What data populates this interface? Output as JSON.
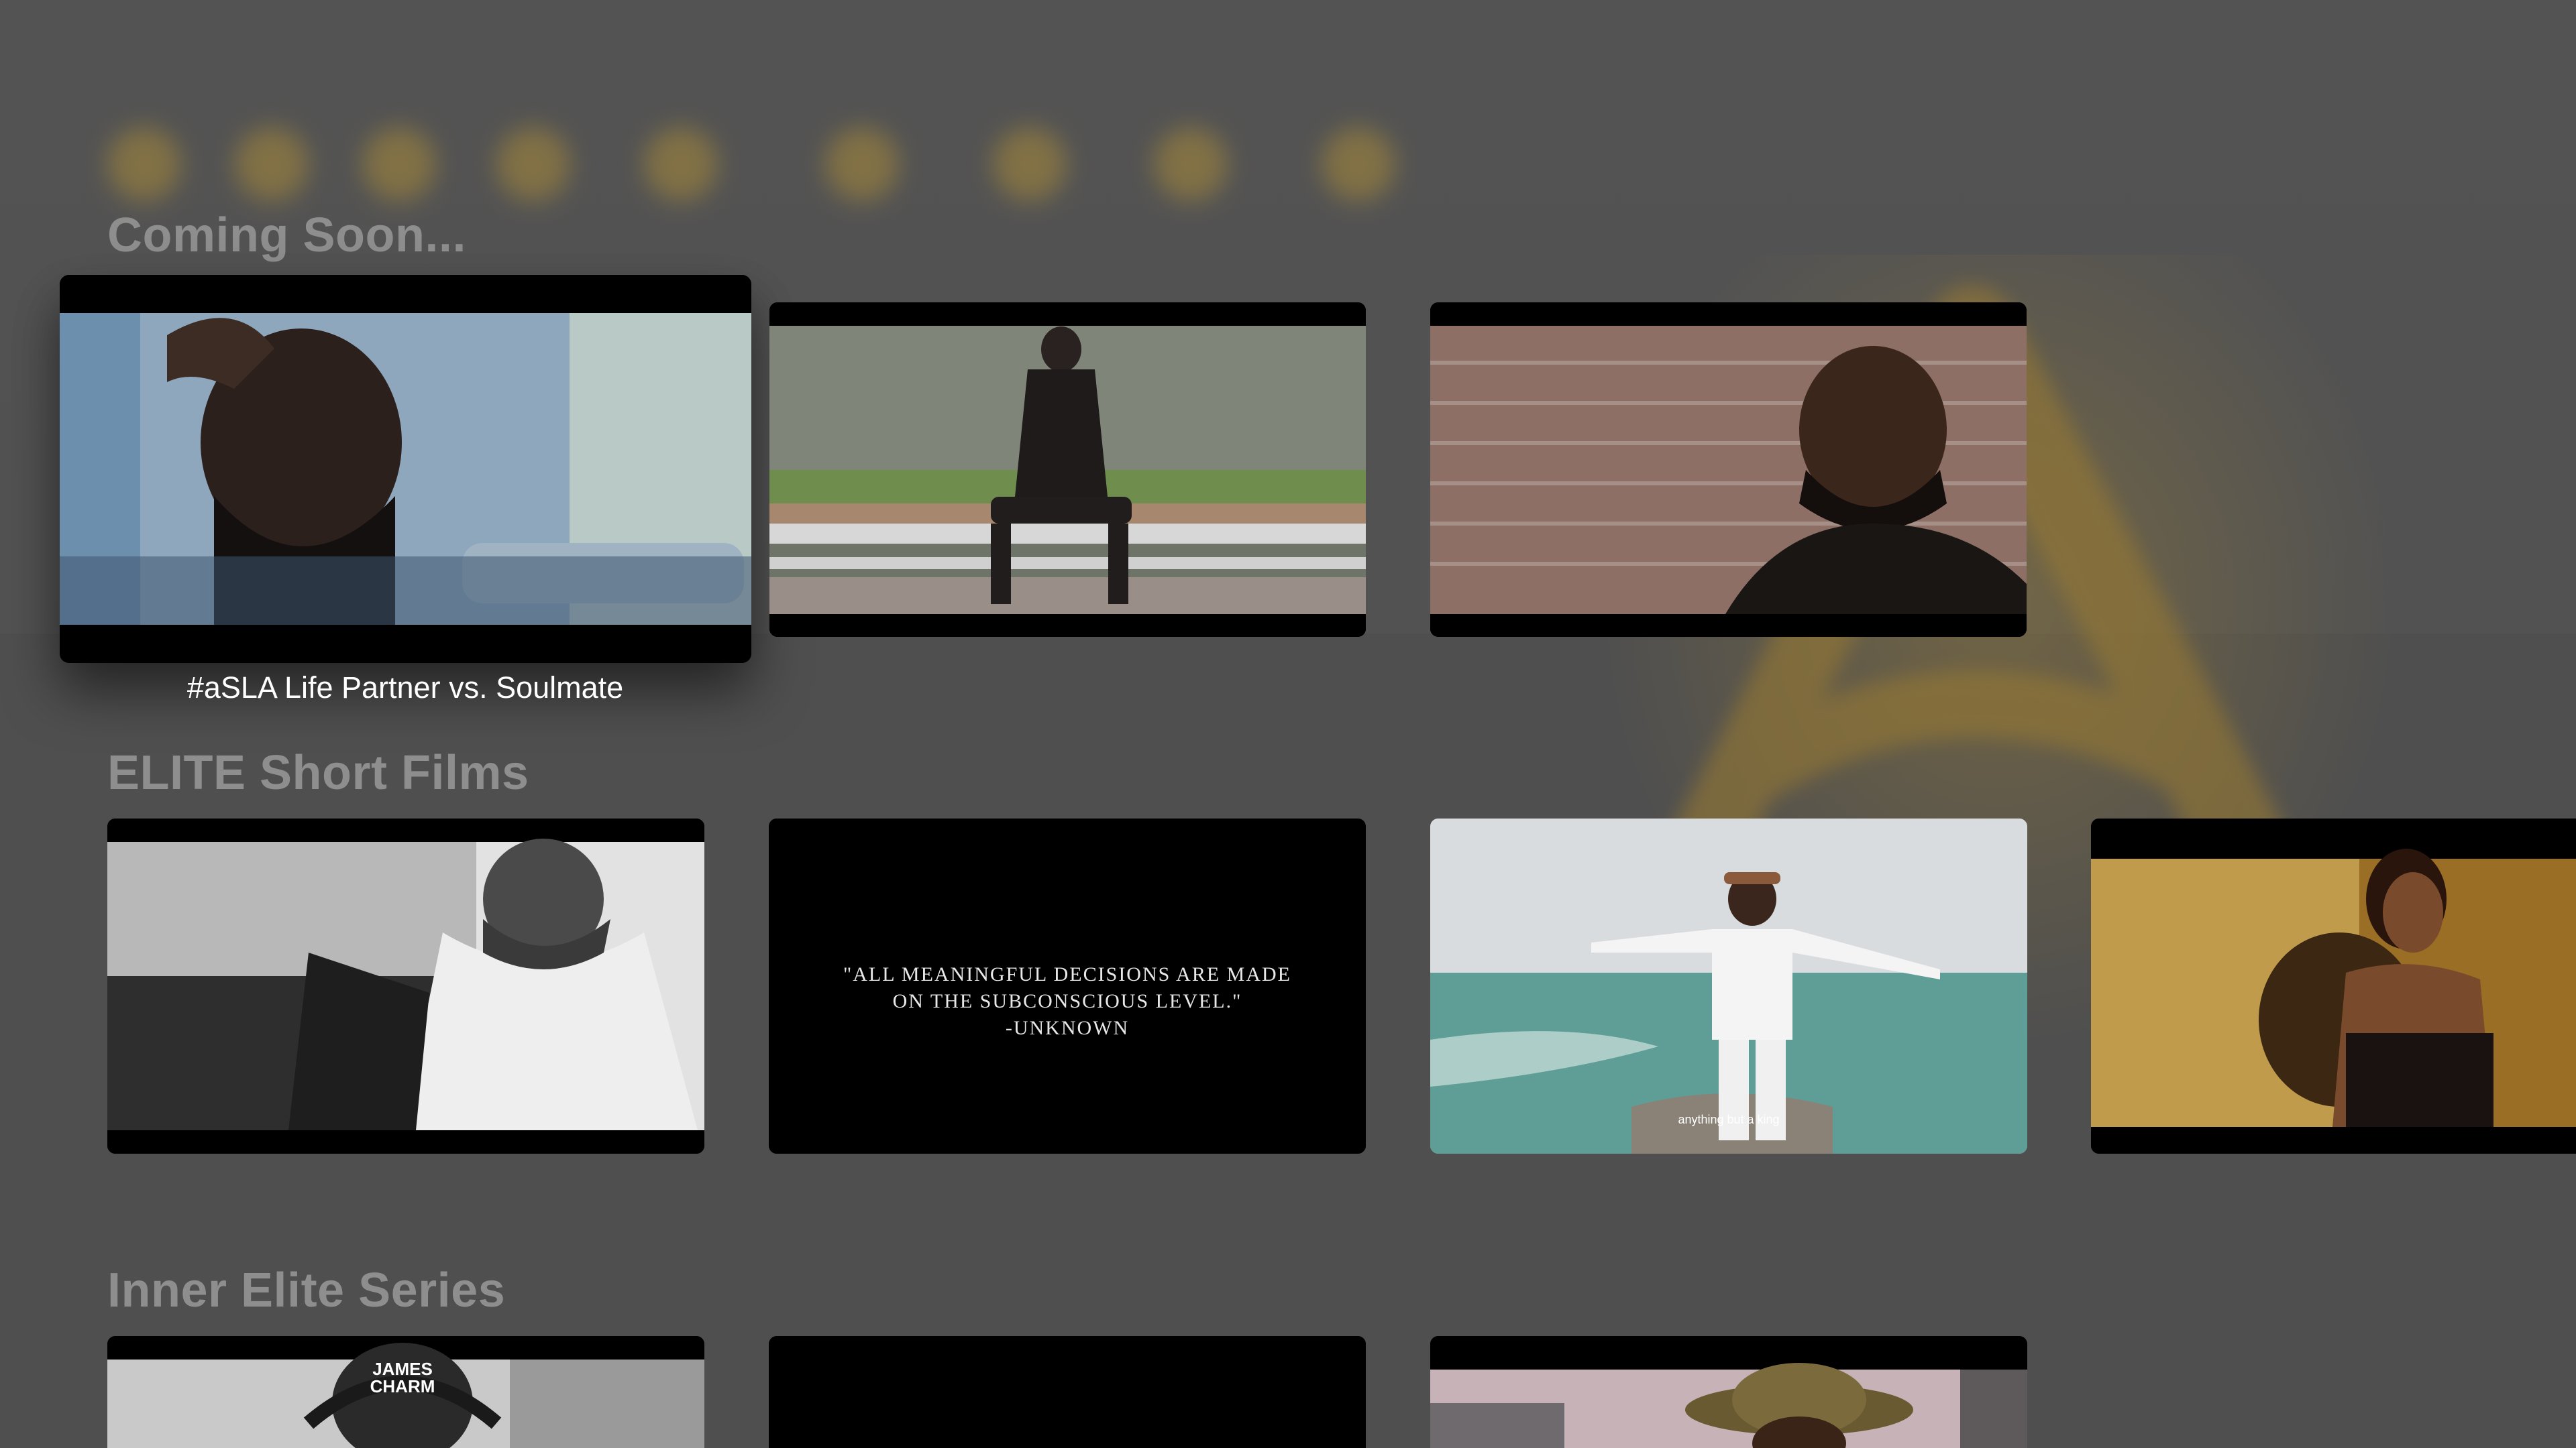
{
  "sections": [
    {
      "title": "Coming Soon...",
      "items": [
        {
          "scene": "man-in-car",
          "caption": "#aSLA Life Partner vs. Soulmate",
          "focused": true
        },
        {
          "scene": "man-on-bleachers"
        },
        {
          "scene": "man-brick-wall"
        }
      ]
    },
    {
      "title": "ELITE Short Films",
      "items": [
        {
          "scene": "bw-man-with-scarf"
        },
        {
          "scene": "quote-card",
          "quote": [
            "\"ALL MEANINGFUL DECISIONS ARE MADE",
            "ON THE SUBCONSCIOUS LEVEL.\"",
            "-UNKNOWN"
          ]
        },
        {
          "scene": "man-arms-outstretched-sea",
          "subtitle": "anything but a king"
        },
        {
          "scene": "woman-speaking"
        }
      ]
    },
    {
      "title": "Inner Elite Series",
      "items": [
        {
          "scene": "man-with-headphones",
          "cap_text": [
            "JAMES",
            "CHARM"
          ]
        },
        {
          "scene": "black-card"
        },
        {
          "scene": "man-with-hat-city"
        }
      ]
    }
  ],
  "colors": {
    "background": "#4f4f4f",
    "section_title": "#8e8e8e",
    "caption": "#ffffff",
    "accent_logo": "#b08c32"
  },
  "icons": {
    "background_logo": "elite-triangle-logo-icon"
  }
}
